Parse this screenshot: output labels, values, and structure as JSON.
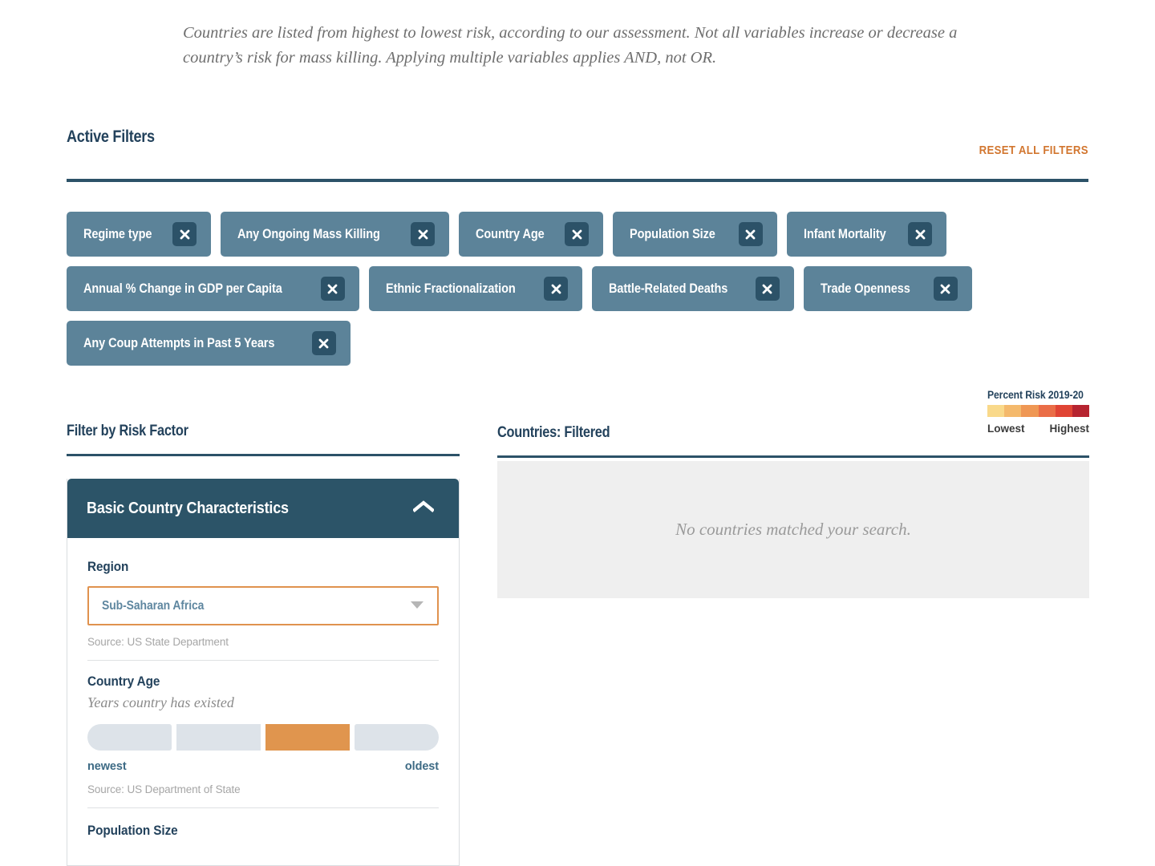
{
  "intro": {
    "text": "Countries are listed from highest to lowest risk, according to our assessment. Not all variables increase or decrease a country’s risk for mass killing. Applying multiple variables applies AND, not OR."
  },
  "active_filters": {
    "title": "Active Filters",
    "reset_label": "RESET ALL FILTERS",
    "rows": [
      [
        "Regime type",
        "Any Ongoing Mass Killing",
        "Country Age",
        "Population Size",
        "Infant Mortality"
      ],
      [
        "Annual % Change in GDP per Capita",
        "Ethnic Fractionalization",
        "Battle-Related Deaths",
        "Trade Openness"
      ],
      [
        "Any Coup Attempts in Past 5 Years"
      ]
    ]
  },
  "legend": {
    "title": "Percent Risk 2019-20",
    "low_label": "Lowest",
    "high_label": "Highest",
    "colors": [
      "#f9d98a",
      "#f4b96c",
      "#ef9754",
      "#ea6d47",
      "#e04434",
      "#b62430"
    ]
  },
  "left_column": {
    "title": "Filter by Risk Factor",
    "panel": {
      "header": "Basic Country Characteristics",
      "collapse_icon": "chevron-up-icon",
      "region": {
        "label": "Region",
        "value": "Sub-Saharan Africa",
        "source": "Source: US State Department"
      },
      "country_age": {
        "label": "Country Age",
        "sublabel": "Years country has existed",
        "segments": 4,
        "selected_index": 2,
        "min_label": "newest",
        "max_label": "oldest",
        "source": "Source: US Department of State"
      },
      "population_size": {
        "label": "Population Size"
      }
    }
  },
  "right_column": {
    "title": "Countries: Filtered",
    "empty_message": "No countries matched your search."
  },
  "colors": {
    "dark_teal": "#2c5468",
    "chip_blue": "#5c8399",
    "orange": "#d2762f",
    "navy": "#23425c"
  }
}
